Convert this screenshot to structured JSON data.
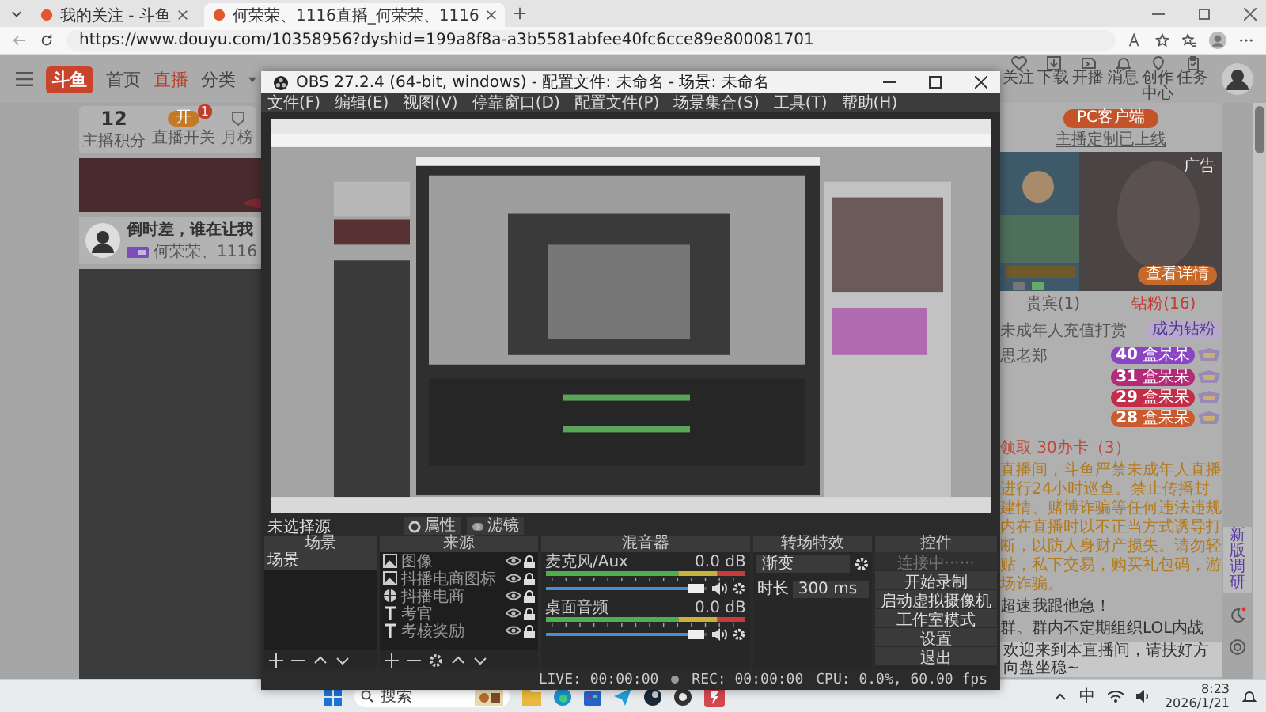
{
  "browser": {
    "tabs": [
      {
        "title": "我的关注 - 斗鱼",
        "selected": false
      },
      {
        "title": "何荣荣、1116直播_何荣荣、1116",
        "selected": true
      }
    ],
    "url": "https://www.douyu.com/10358956?dyshid=199a8f8a-a3b5581abfee40fc6cce89e800081701"
  },
  "douyu": {
    "logo_text": "斗鱼",
    "nav": [
      {
        "label": "首页",
        "selected": false
      },
      {
        "label": "直播",
        "selected": true
      },
      {
        "label": "分类",
        "selected": false
      }
    ],
    "header_icons": [
      {
        "label": "关注",
        "kind": "heart"
      },
      {
        "label": "下载",
        "kind": "download"
      },
      {
        "label": "开播",
        "kind": "camera"
      },
      {
        "label": "消息",
        "kind": "bell"
      },
      {
        "label": "创作中心",
        "kind": "pin"
      },
      {
        "label": "任务",
        "kind": "task"
      }
    ],
    "stats": {
      "points_value": "12",
      "points_label": "主播积分",
      "switch_text": "开",
      "switch_on": true,
      "switch_badge": "1",
      "switch_label": "直播开关",
      "rank_label": "月榜"
    },
    "stream": {
      "title": "倒时差，谁在让我",
      "streamer": "何荣荣、1116"
    },
    "pc_button": "PC客户端",
    "custom_note": "主播定制已上线",
    "ad_label": "广告",
    "ad_button": "查看详情",
    "tabs": [
      {
        "label": "贵宾(1)",
        "selected": false
      },
      {
        "label": "钻粉(16)",
        "selected": true
      }
    ],
    "notice": "未成年人充值打赏",
    "join_button": "成为钻粉",
    "fans": [
      {
        "name": "思老郑",
        "level": "40",
        "badge": "盒呆呆",
        "color": "#8a44c4"
      },
      {
        "level": "31",
        "badge": "盒呆呆",
        "color": "#b52a78"
      },
      {
        "level": "29",
        "badge": "盒呆呆",
        "color": "#c42c48"
      },
      {
        "level": "28",
        "badge": "盒呆呆",
        "color": "#cc5a2e"
      }
    ],
    "perks": "领取 30办卡（3）",
    "warning": "直播间，斗鱼严禁未成年人直播进行24小时巡查。禁止传播封建情、赌博诈骗等任何违法违规内在直播时以不正当方式诱导打断，以防人身财产损失。请勿轻贴，私下交易，购买礼包码，游场诈骗。",
    "chat": [
      "超速我跟他急！",
      "群。群内不定期组织LOL内战"
    ],
    "welcome": "欢迎来到本直播间，请扶好方向盘坐稳~",
    "side_button": "新版调研"
  },
  "obs": {
    "title": "OBS 27.2.4 (64-bit, windows) - 配置文件: 未命名 - 场景: 未命名",
    "menu": [
      "文件(F)",
      "编辑(E)",
      "视图(V)",
      "停靠窗口(D)",
      "配置文件(P)",
      "场景集合(S)",
      "工具(T)",
      "帮助(H)"
    ],
    "no_source": "未选择源",
    "properties": "属性",
    "filters": "滤镜",
    "scenes": {
      "title": "场景",
      "items": [
        {
          "label": "场景",
          "selected": true
        }
      ]
    },
    "sources": {
      "title": "来源",
      "items": [
        {
          "label": "图像",
          "visible": true,
          "locked": true
        },
        {
          "label": "抖播电商图标",
          "visible": true,
          "locked": true
        },
        {
          "label": "抖播电商",
          "kind": "browser",
          "visible": true,
          "locked": true
        },
        {
          "label": "考官",
          "kind": "text",
          "visible": true,
          "locked": true
        },
        {
          "label": "考核奖励",
          "kind": "text",
          "visible": true,
          "locked": true
        }
      ]
    },
    "mixer": {
      "title": "混音器",
      "channels": [
        {
          "name": "麦克风/Aux",
          "reading": "0.0 dB",
          "level": 0.93
        },
        {
          "name": "桌面音频",
          "reading": "0.0 dB",
          "level": 0.93
        }
      ]
    },
    "transitions": {
      "title": "转场特效",
      "type": "渐变",
      "duration_label": "时长",
      "duration": "300 ms"
    },
    "controls": {
      "title": "控件",
      "buttons": [
        {
          "label": "连接中······",
          "disabled": true
        },
        {
          "label": "开始录制",
          "disabled": false
        },
        {
          "label": "启动虚拟摄像机",
          "disabled": false
        },
        {
          "label": "工作室模式",
          "disabled": false
        },
        {
          "label": "设置",
          "disabled": false
        },
        {
          "label": "退出",
          "disabled": false
        }
      ]
    },
    "status": {
      "live": "LIVE: 00:00:00",
      "rec": "REC: 00:00:00",
      "cpu": "CPU: 0.0%, 60.00 fps"
    }
  },
  "taskbar": {
    "search": "搜索",
    "language": "中",
    "time": "8:23",
    "date": "2026/1/21"
  }
}
